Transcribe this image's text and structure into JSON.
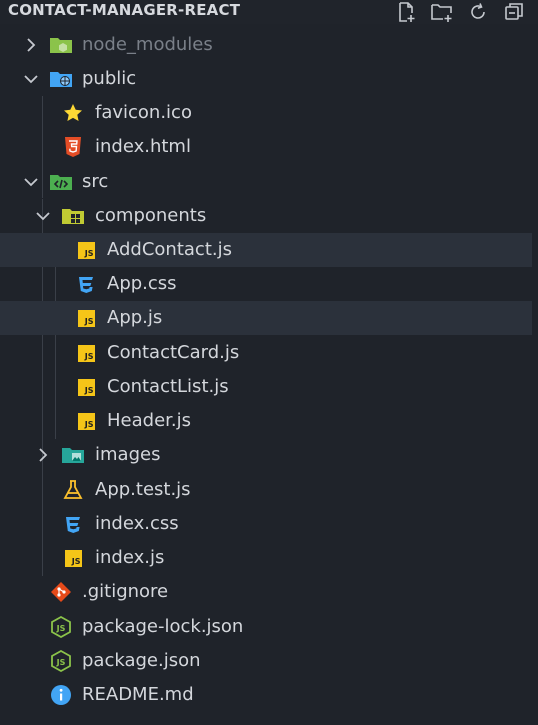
{
  "explorer": {
    "project_name": "CONTACT-MANAGER-REACT",
    "toolbar": [
      {
        "icon": "new-file-icon"
      },
      {
        "icon": "new-folder-icon"
      },
      {
        "icon": "refresh-icon"
      },
      {
        "icon": "collapse-all-icon"
      }
    ],
    "items": [
      {
        "label": "node_modules",
        "type": "folder",
        "expanded": false,
        "icon": "node-folder-icon",
        "dimmed": true
      },
      {
        "label": "public",
        "type": "folder",
        "expanded": true,
        "icon": "public-folder-icon"
      },
      {
        "label": "favicon.ico",
        "type": "file",
        "icon": "star-icon"
      },
      {
        "label": "index.html",
        "type": "file",
        "icon": "html5-icon"
      },
      {
        "label": "src",
        "type": "folder",
        "expanded": true,
        "icon": "src-folder-icon"
      },
      {
        "label": "components",
        "type": "folder",
        "expanded": true,
        "icon": "components-folder-icon"
      },
      {
        "label": "AddContact.js",
        "type": "file",
        "icon": "javascript-icon"
      },
      {
        "label": "App.css",
        "type": "file",
        "icon": "css3-icon"
      },
      {
        "label": "App.js",
        "type": "file",
        "icon": "javascript-icon",
        "selected": true
      },
      {
        "label": "ContactCard.js",
        "type": "file",
        "icon": "javascript-icon"
      },
      {
        "label": "ContactList.js",
        "type": "file",
        "icon": "javascript-icon"
      },
      {
        "label": "Header.js",
        "type": "file",
        "icon": "javascript-icon"
      },
      {
        "label": "images",
        "type": "folder",
        "expanded": false,
        "icon": "images-folder-icon"
      },
      {
        "label": "App.test.js",
        "type": "file",
        "icon": "test-flask-icon"
      },
      {
        "label": "index.css",
        "type": "file",
        "icon": "css3-icon"
      },
      {
        "label": "index.js",
        "type": "file",
        "icon": "javascript-icon"
      },
      {
        "label": ".gitignore",
        "type": "file",
        "icon": "git-icon"
      },
      {
        "label": "package-lock.json",
        "type": "file",
        "icon": "nodejs-icon"
      },
      {
        "label": "package.json",
        "type": "file",
        "icon": "nodejs-icon"
      },
      {
        "label": "README.md",
        "type": "file",
        "icon": "info-icon"
      }
    ]
  },
  "colors": {
    "background": "#1f232a",
    "selected_row": "#2b313b",
    "text": "#d4d7dc",
    "dimmed_text": "#7a8089",
    "js_yellow": "#f5c518",
    "css_blue": "#42a5f5",
    "html_orange": "#e44d26",
    "node_green": "#8bc34a",
    "git_red": "#e64a19"
  }
}
